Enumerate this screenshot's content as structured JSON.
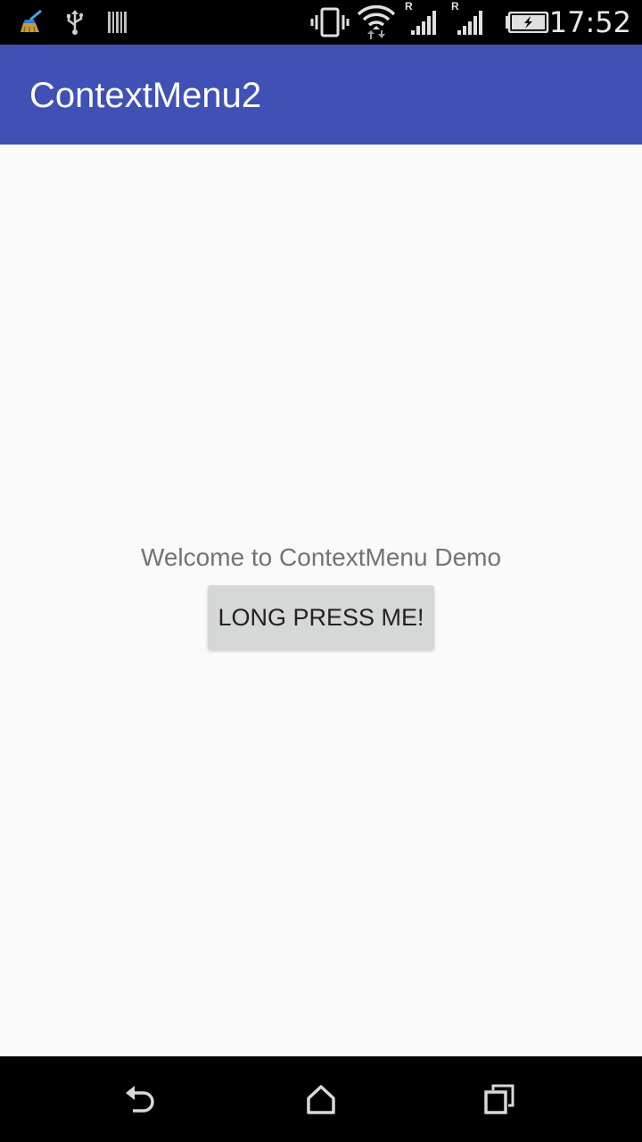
{
  "status_bar": {
    "time": "17:52",
    "network_roaming_labels": [
      "R",
      "R"
    ],
    "icons": [
      "cleaner-icon",
      "usb-icon",
      "barcode-icon",
      "vibrate-icon",
      "wifi-icon",
      "signal-icon",
      "signal-icon",
      "battery-charging-icon"
    ]
  },
  "app_bar": {
    "title": "ContextMenu2",
    "color": "#3f51b5"
  },
  "main": {
    "welcome_text": "Welcome to ContextMenu Demo",
    "button_label": "LONG PRESS ME!"
  },
  "nav_bar": {
    "buttons": [
      "back-icon",
      "home-icon",
      "recents-icon"
    ]
  }
}
